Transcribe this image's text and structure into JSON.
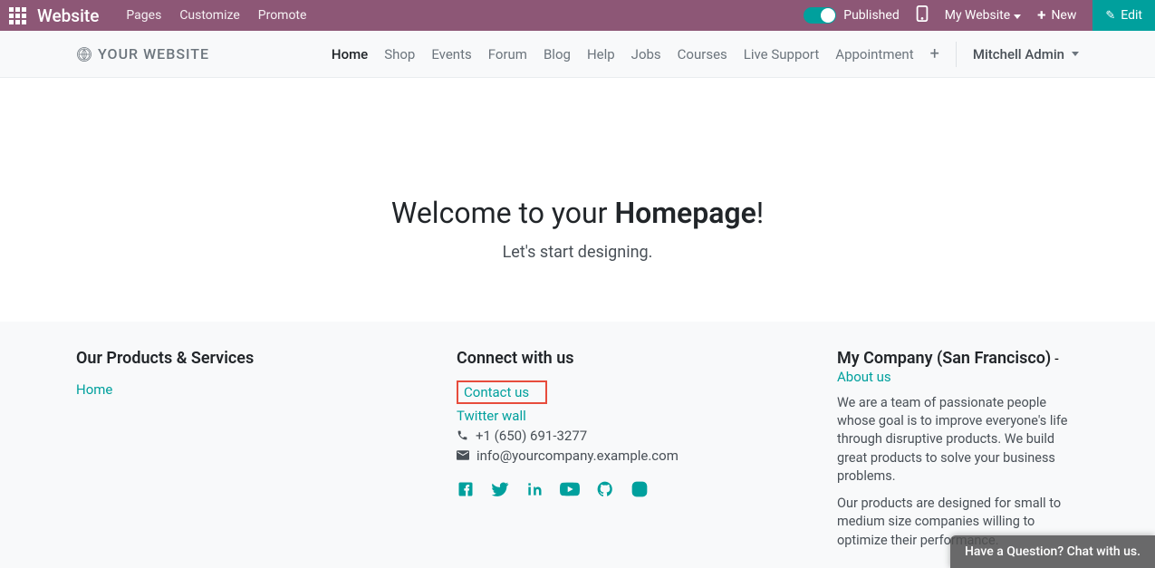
{
  "topbar": {
    "brand": "Website",
    "pages": "Pages",
    "customize": "Customize",
    "promote": "Promote",
    "published": "Published",
    "my_website": "My Website",
    "new": "New",
    "edit": "Edit"
  },
  "sitebar": {
    "logo": "YOUR WEBSITE",
    "menu": [
      "Home",
      "Shop",
      "Events",
      "Forum",
      "Blog",
      "Help",
      "Jobs",
      "Courses",
      "Live Support",
      "Appointment"
    ],
    "user": "Mitchell Admin"
  },
  "hero": {
    "title_pre": "Welcome to your ",
    "title_bold": "Homepage",
    "title_post": "!",
    "subtitle": "Let's start designing."
  },
  "footer": {
    "col1": {
      "heading": "Our Products & Services",
      "home": "Home"
    },
    "col2": {
      "heading": "Connect with us",
      "contact": "Contact us",
      "twitter": "Twitter wall",
      "phone": "+1 (650) 691-3277",
      "email": "info@yourcompany.example.com"
    },
    "col3": {
      "heading": "My Company (San Francisco)",
      "dash": " - ",
      "about": "About us",
      "p1": "We are a team of passionate people whose goal is to improve everyone's life through disruptive products. We build great products to solve your business problems.",
      "p2": "Our products are designed for small to medium size companies willing to optimize their performance."
    }
  },
  "chat": "Have a Question? Chat with us."
}
